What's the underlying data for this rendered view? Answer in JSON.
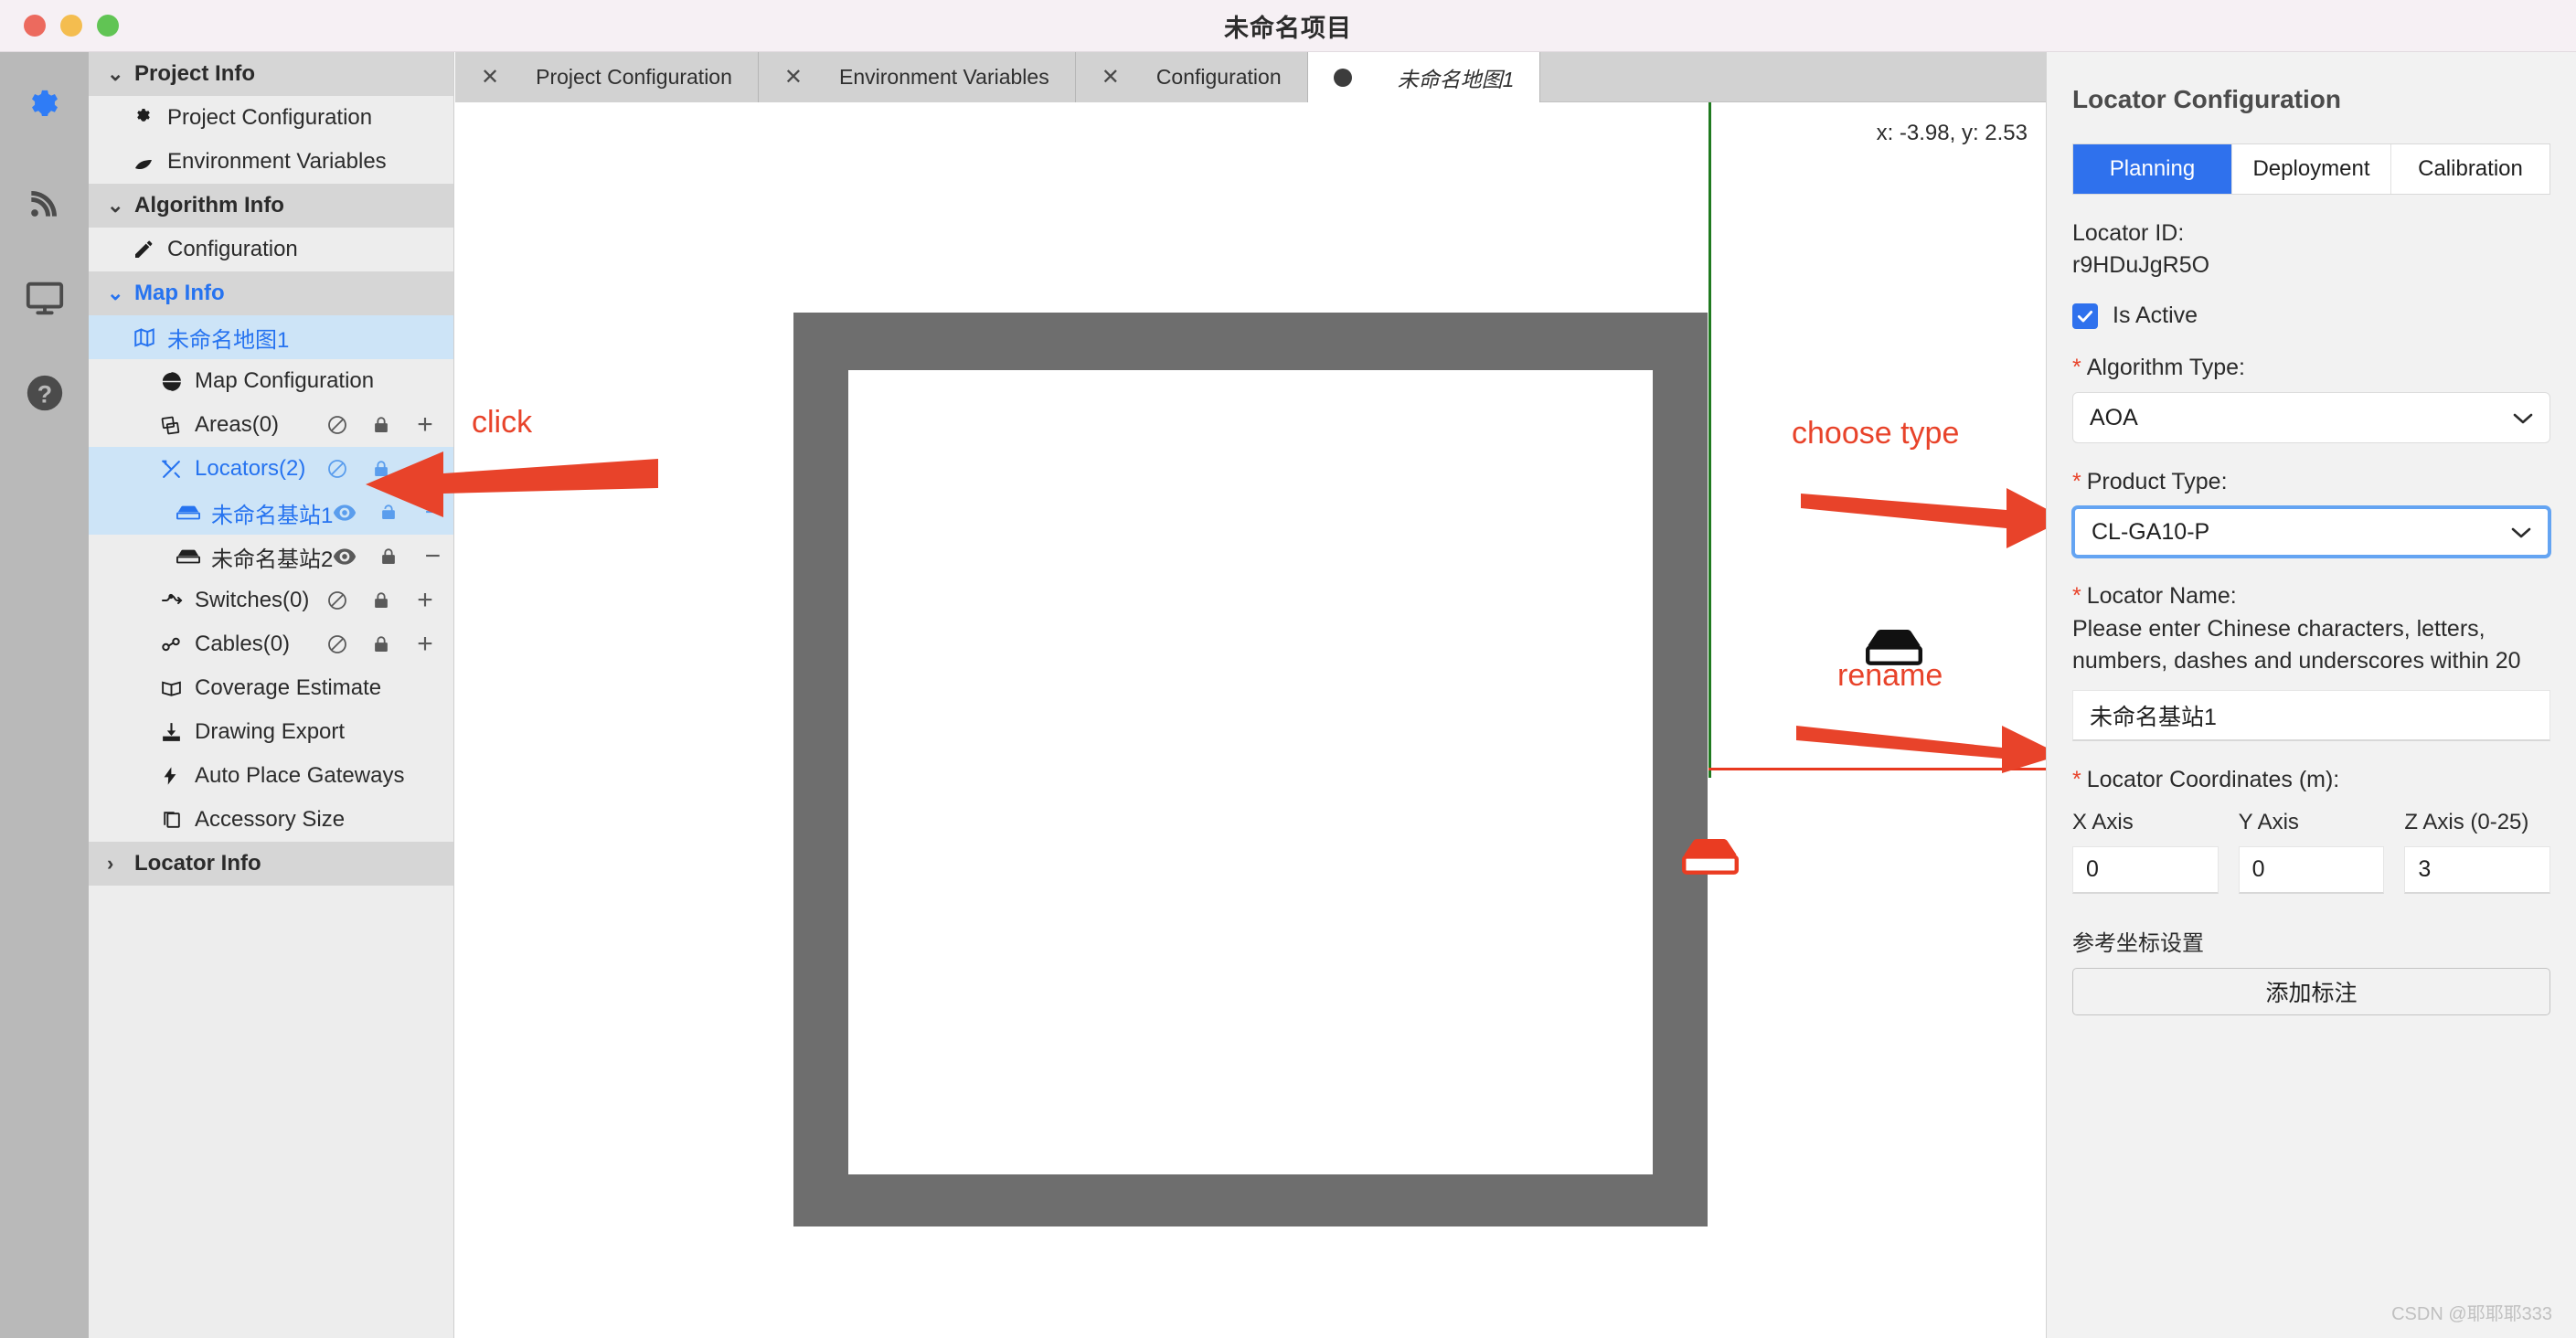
{
  "window": {
    "title": "未命名项目",
    "traffic_lights": [
      "close-red",
      "minimize-yellow",
      "zoom-green"
    ]
  },
  "rail": {
    "items": [
      {
        "name": "gear-icon",
        "label": "Settings",
        "active": true
      },
      {
        "name": "signal-icon",
        "label": "Signal",
        "active": false
      },
      {
        "name": "monitor-icon",
        "label": "Monitor",
        "active": false
      },
      {
        "name": "help-icon",
        "label": "Help",
        "active": false
      }
    ]
  },
  "sidebar": {
    "groups": [
      {
        "label": "Project Info",
        "caret": "⌄",
        "expanded": true,
        "highlight": false
      },
      {
        "label": "Algorithm Info",
        "caret": "⌄",
        "expanded": true,
        "highlight": false
      },
      {
        "label": "Map Info",
        "caret": "⌄",
        "expanded": true,
        "highlight": true
      },
      {
        "label": "Locator Info",
        "caret": "›",
        "expanded": false,
        "highlight": false
      }
    ],
    "project_items": [
      {
        "icon": "gear-icon",
        "label": "Project Configuration"
      },
      {
        "icon": "leaf-icon",
        "label": "Environment Variables"
      }
    ],
    "algorithm_items": [
      {
        "icon": "pencil-icon",
        "label": "Configuration"
      }
    ],
    "map_items": [
      {
        "icon": "map-icon",
        "label": "未命名地图1",
        "selected": true,
        "indent": 1,
        "actions": []
      },
      {
        "icon": "globe-icon",
        "label": "Map Configuration",
        "selected": false,
        "indent": 1,
        "actions": []
      },
      {
        "icon": "layers-icon",
        "label": "Areas(0)",
        "selected": false,
        "indent": 1,
        "actions": [
          "block",
          "lock",
          "plus"
        ]
      },
      {
        "icon": "tools-icon",
        "label": "Locators(2)",
        "selected": true,
        "indent": 1,
        "actions": [
          "block",
          "lock",
          "plus"
        ]
      },
      {
        "icon": "locator-icon",
        "label": "未命名基站1",
        "selected": true,
        "indent": 2,
        "actions": [
          "eye",
          "unlock",
          "minus"
        ]
      },
      {
        "icon": "locator-icon",
        "label": "未命名基站2",
        "selected": false,
        "indent": 2,
        "actions": [
          "eye",
          "lock",
          "minus"
        ]
      },
      {
        "icon": "switch-icon",
        "label": "Switches(0)",
        "selected": false,
        "indent": 1,
        "actions": [
          "block",
          "lock",
          "plus"
        ]
      },
      {
        "icon": "cable-icon",
        "label": "Cables(0)",
        "selected": false,
        "indent": 1,
        "actions": [
          "block",
          "lock",
          "plus"
        ]
      },
      {
        "icon": "coverage-icon",
        "label": "Coverage Estimate",
        "selected": false,
        "indent": 1,
        "actions": []
      },
      {
        "icon": "download-icon",
        "label": "Drawing Export",
        "selected": false,
        "indent": 1,
        "actions": []
      },
      {
        "icon": "bolt-icon",
        "label": "Auto Place Gateways",
        "selected": false,
        "indent": 1,
        "actions": []
      },
      {
        "icon": "copy-icon",
        "label": "Accessory Size",
        "selected": false,
        "indent": 1,
        "actions": []
      }
    ]
  },
  "tabs": [
    {
      "label": "Project Configuration",
      "closable": true,
      "active": false
    },
    {
      "label": "Environment Variables",
      "closable": true,
      "active": false
    },
    {
      "label": "Configuration",
      "closable": true,
      "active": false
    },
    {
      "label": "未命名地图1",
      "closable": false,
      "active": true
    }
  ],
  "canvas": {
    "coord_readout": "x: -3.98, y: 2.53",
    "markers": [
      {
        "name": "locator-marker-black",
        "color": "#111111"
      },
      {
        "name": "locator-marker-red",
        "color": "#e8381f"
      }
    ],
    "axis_v_color": "#1f7a1f",
    "axis_h_color": "#e8381f"
  },
  "annotations": [
    {
      "id": "click",
      "text": "click"
    },
    {
      "id": "choose-type",
      "text": "choose type"
    },
    {
      "id": "rename",
      "text": "rename"
    }
  ],
  "panel": {
    "title": "Locator Configuration",
    "tabs": [
      {
        "label": "Planning",
        "active": true
      },
      {
        "label": "Deployment",
        "active": false
      },
      {
        "label": "Calibration",
        "active": false
      }
    ],
    "locator_id_label": "Locator ID:",
    "locator_id_value": "r9HDuJgR5O",
    "is_active_label": "Is Active",
    "is_active_checked": true,
    "algorithm_type_label": "Algorithm Type:",
    "algorithm_type_value": "AOA",
    "product_type_label": "Product Type:",
    "product_type_value": "CL-GA10-P",
    "locator_name_label": "Locator Name:",
    "locator_name_hint": "Please enter Chinese characters, letters, numbers, dashes and underscores within 20",
    "locator_name_value": "未命名基站1",
    "coordinates_label": "Locator Coordinates (m):",
    "axes": [
      {
        "header": "X Axis",
        "value": "0"
      },
      {
        "header": "Y Axis",
        "value": "0"
      },
      {
        "header": "Z Axis (0-25)",
        "value": "3"
      }
    ],
    "reference_label": "参考坐标设置",
    "add_annotation_button": "添加标注"
  },
  "watermark": "CSDN @耶耶耶333",
  "colors": {
    "accent_blue": "#2673f0",
    "tab_blue": "#2f71ed",
    "annotation_red": "#e8432a",
    "selection_blue": "#cde4f7"
  }
}
